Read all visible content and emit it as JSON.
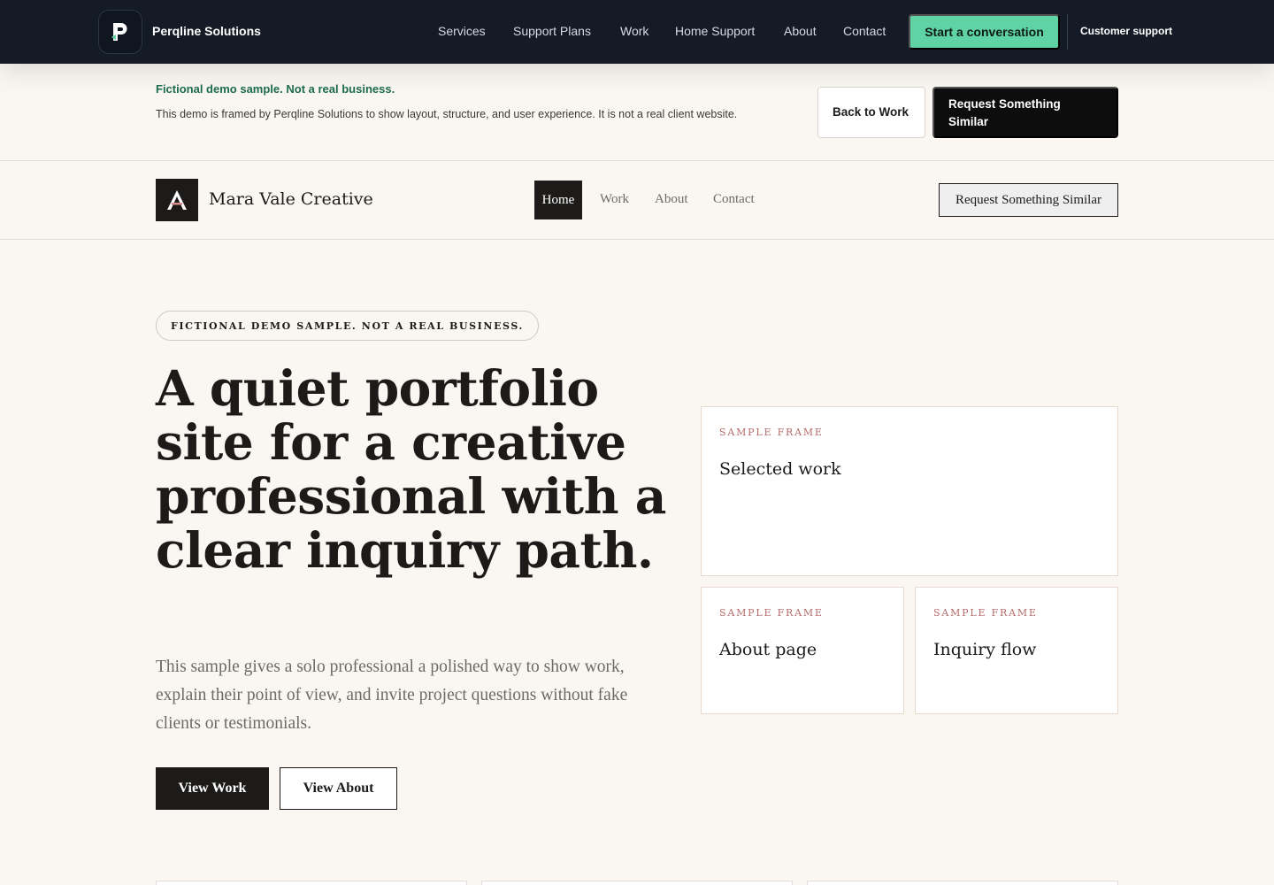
{
  "agency": {
    "brand": "Perqline Solutions",
    "nav": [
      "Services",
      "Support Plans",
      "Work",
      "Home Support",
      "About",
      "Contact"
    ],
    "cta": "Start a conversation",
    "support": "Customer support"
  },
  "notice": {
    "title": "Fictional demo sample. Not a real business.",
    "text": "This demo is framed by Perqline Solutions to show layout, structure, and user experience. It is not a real client website.",
    "back_label": "Back to Work",
    "request_label": "Request Something Similar"
  },
  "client": {
    "name": "Mara Vale Creative",
    "nav": {
      "home": "Home",
      "work": "Work",
      "about": "About",
      "contact": "Contact"
    },
    "request_label": "Request Something Similar"
  },
  "hero": {
    "pill": "FICTIONAL DEMO SAMPLE. NOT A REAL BUSINESS.",
    "title": "A quiet portfolio site for a creative professional with a clear inquiry path.",
    "subtitle": "This sample gives a solo professional a polished way to show work, explain their point of view, and invite project questions without fake clients or testimonials.",
    "view_work": "View Work",
    "view_about": "View About"
  },
  "frames": [
    {
      "label": "SAMPLE FRAME",
      "title": "Selected work"
    },
    {
      "label": "SAMPLE FRAME",
      "title": "About page"
    },
    {
      "label": "SAMPLE FRAME",
      "title": "Inquiry flow"
    }
  ],
  "colors": {
    "topbar": "#151b26",
    "accent_green": "#5fd3a4",
    "notice_green": "#1d6b4e",
    "frame_label": "#b56b6b",
    "ink": "#1c1b19"
  }
}
